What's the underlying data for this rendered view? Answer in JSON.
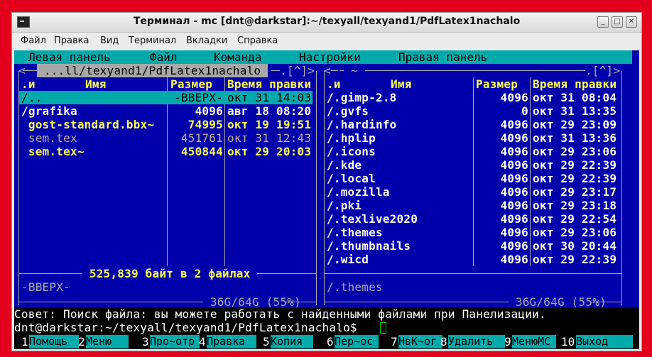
{
  "window": {
    "title": "Терминал - mc [dnt@darkstar]:~/texyall/texyand1/PdfLatex1nachalo",
    "minimize": "_",
    "maximize": "□",
    "close": "✕",
    "icon": "terminal-icon"
  },
  "menubar": [
    "Файл",
    "Правка",
    "Вид",
    "Терминал",
    "Вкладки",
    "Справка"
  ],
  "mc_menu": [
    "Левая панель",
    "Файл",
    "Команда",
    "Настройки",
    "Правая панель"
  ],
  "left_panel": {
    "path": " ...ll/texyand1/PdfLatex1nachalo ",
    "corner": "<─",
    "controls": ".[^]>",
    "headers": {
      "sort": ".и",
      "name": "Имя",
      "size": "Размер",
      "mtime": "Время правки"
    },
    "rows": [
      {
        "name": "/..",
        "size": "-ВВЕРХ-",
        "mtime": "окт 31 14:03",
        "style": "selected"
      },
      {
        "name": "/grafika",
        "size": "4096",
        "mtime": "авг 18 08:20",
        "style": "dir"
      },
      {
        "name": " gost-standard.bbx~",
        "size": "74995",
        "mtime": "окт 19 19:51",
        "style": "bak"
      },
      {
        "name": " sem.tex",
        "size": "451761",
        "mtime": "окт 31 12:43",
        "style": "dim"
      },
      {
        "name": " sem.tex~",
        "size": "450844",
        "mtime": "окт 29 20:03",
        "style": "bak"
      }
    ],
    "summary": " 525,839 байт в 2 файлах ",
    "status": "-ВВЕРХ-",
    "disk": " 36G/64G (55%) "
  },
  "right_panel": {
    "path": " ~ ",
    "corner": "<─",
    "controls": ".[^]>",
    "headers": {
      "sort": ".и",
      "name": "Имя",
      "size": "Размер",
      "mtime": "Время правки"
    },
    "rows": [
      {
        "name": "/.gimp-2.8",
        "size": "4096",
        "mtime": "окт 31 08:04"
      },
      {
        "name": "/.gvfs",
        "size": "0",
        "mtime": "окт 31 13:35"
      },
      {
        "name": "/.hardinfo",
        "size": "4096",
        "mtime": "окт 29 23:09"
      },
      {
        "name": "/.hplip",
        "size": "4096",
        "mtime": "окт 31 13:36"
      },
      {
        "name": "/.icons",
        "size": "4096",
        "mtime": "окт 29 23:06"
      },
      {
        "name": "/.kde",
        "size": "4096",
        "mtime": "окт 29 22:39"
      },
      {
        "name": "/.local",
        "size": "4096",
        "mtime": "окт 29 22:39"
      },
      {
        "name": "/.mozilla",
        "size": "4096",
        "mtime": "окт 29 23:17"
      },
      {
        "name": "/.pki",
        "size": "4096",
        "mtime": "окт 29 23:18"
      },
      {
        "name": "/.texlive2020",
        "size": "4096",
        "mtime": "окт 29 22:54"
      },
      {
        "name": "/.themes",
        "size": "4096",
        "mtime": "окт 29 23:06"
      },
      {
        "name": "/.thumbnails",
        "size": "4096",
        "mtime": "окт 30 20:44"
      },
      {
        "name": "/.wicd",
        "size": "4096",
        "mtime": "окт 29 22:39"
      }
    ],
    "status": "/.themes",
    "disk": " 36G/64G (55%) "
  },
  "hint": "Совет: Поиск файла: вы можете работать с найденными файлами при Панелизации.",
  "prompt": "dnt@darkstar:~/texyall/texyand1/PdfLatex1nachalo$ ",
  "fkeys": [
    {
      "num": "1",
      "label": "Помощь"
    },
    {
      "num": "2",
      "label": "Меню"
    },
    {
      "num": "3",
      "label": "Про~отр"
    },
    {
      "num": "4",
      "label": "Правка"
    },
    {
      "num": "5",
      "label": "Копия"
    },
    {
      "num": "6",
      "label": "Пер~ос"
    },
    {
      "num": "7",
      "label": "НвК~ог"
    },
    {
      "num": "8",
      "label": "Удалить"
    },
    {
      "num": "9",
      "label": "МенюMC"
    },
    {
      "num": "10",
      "label": "Выход"
    }
  ],
  "colors": {
    "panel_bg": "#0000aa",
    "accent": "#00aaaa",
    "highlight": "#ffff55",
    "frame": "#e3001c"
  }
}
